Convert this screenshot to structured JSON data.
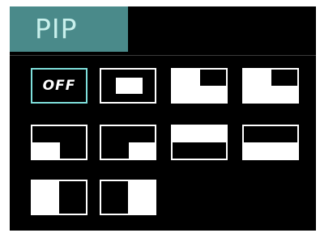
{
  "header": {
    "title": "PIP"
  },
  "options": [
    {
      "name": "pip-off-option",
      "label": "OFF",
      "selected": true
    },
    {
      "name": "pip-center-option",
      "layout": "center-window"
    },
    {
      "name": "pip-top-right-option",
      "layout": "top-right-window"
    },
    {
      "name": "pip-top-right-small-option",
      "layout": "top-right-small-window"
    },
    {
      "name": "pip-bottom-left-option",
      "layout": "bottom-left-window"
    },
    {
      "name": "pip-bottom-right-option",
      "layout": "bottom-right-window"
    },
    {
      "name": "pip-split-top-bottom-option",
      "layout": "split-horizontal"
    },
    {
      "name": "pip-split-top-bottom-alt-option",
      "layout": "split-horizontal-alt"
    },
    {
      "name": "pip-split-left-right-option",
      "layout": "split-vertical"
    },
    {
      "name": "pip-split-left-right-alt-option",
      "layout": "split-vertical-alt"
    }
  ],
  "colors": {
    "header_bg": "#4a8a8a",
    "header_text": "#c8f0ec",
    "selected_border": "#7fe0dc",
    "background": "#000000",
    "icon": "#ffffff"
  }
}
